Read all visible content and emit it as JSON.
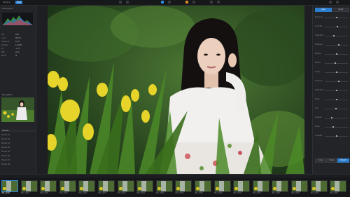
{
  "topbar": {
    "tabs": [
      "Library",
      "Edit"
    ],
    "active_tab": "Edit"
  },
  "left_panel": {
    "histogram_label": "Histogram",
    "info_rows": [
      {
        "k": "ISO",
        "v": "200"
      },
      {
        "k": "Lens",
        "v": "85mm"
      },
      {
        "k": "Aperture",
        "v": "f/1.8"
      },
      {
        "k": "Shutter",
        "v": "1/1000"
      },
      {
        "k": "EV",
        "v": "+0.3"
      },
      {
        "k": "WB",
        "v": "Auto"
      },
      {
        "k": "Mode",
        "v": "M"
      }
    ],
    "navigator_label": "Navigator",
    "list_head": "Presets",
    "list_items": [
      "Preset 01",
      "Preset 02",
      "Preset 03",
      "Preset 04",
      "Preset 05",
      "Preset 06",
      "Preset 07",
      "Preset 08"
    ]
  },
  "right_panel": {
    "buttons": [
      "Auto",
      "Reset"
    ],
    "sliders": [
      {
        "label": "Exposure",
        "level": 0.5
      },
      {
        "label": "Contrast",
        "level": 0.55
      },
      {
        "label": "Highlights",
        "level": 0.4
      },
      {
        "label": "Shadows",
        "level": 0.6
      },
      {
        "label": "Whites",
        "level": 0.5
      },
      {
        "label": "Blacks",
        "level": 0.45
      },
      {
        "label": "Clarity",
        "level": 0.5
      },
      {
        "label": "Vibrance",
        "level": 0.6
      },
      {
        "label": "Saturation",
        "level": 0.5
      },
      {
        "label": "Temp",
        "level": 0.52
      },
      {
        "label": "Tint",
        "level": 0.48
      },
      {
        "label": "Sharpen",
        "level": 0.3
      },
      {
        "label": "Noise",
        "level": 0.35
      },
      {
        "label": "Vignette",
        "level": 0.5
      }
    ],
    "bottom_buttons": [
      "Copy",
      "Paste",
      "Export"
    ]
  },
  "filmstrip": {
    "caption": "IMG_0000",
    "count": 18,
    "selected_index": 0
  }
}
